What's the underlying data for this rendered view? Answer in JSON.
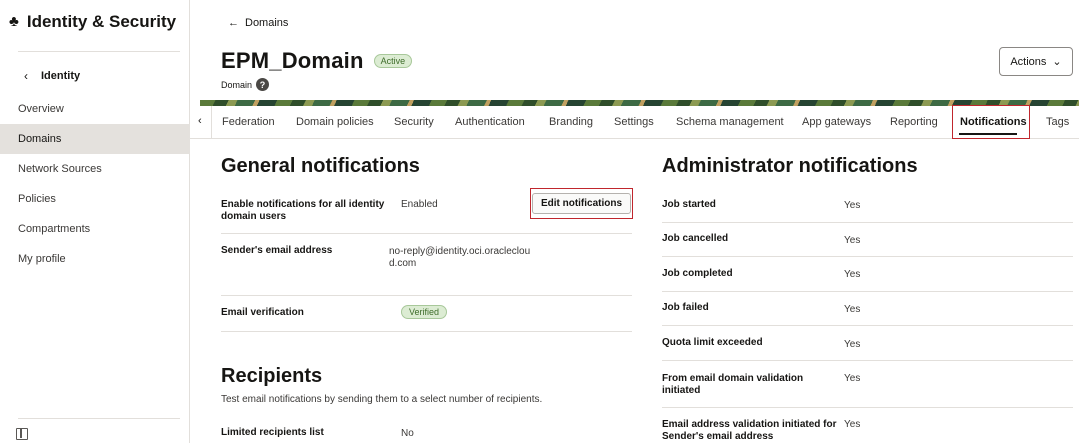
{
  "sidebar": {
    "brand_title": "Identity & Security",
    "brand_icon": "identity-security-logo",
    "back_label": "Identity",
    "items": [
      {
        "label": "Overview"
      },
      {
        "label": "Domains",
        "active": true
      },
      {
        "label": "Network Sources"
      },
      {
        "label": "Policies"
      },
      {
        "label": "Compartments"
      },
      {
        "label": "My profile"
      }
    ]
  },
  "header": {
    "breadcrumb": "Domains",
    "title": "EPM_Domain",
    "status": "Active",
    "subtitle": "Domain",
    "actions_label": "Actions"
  },
  "tabs": [
    {
      "label": "Federation"
    },
    {
      "label": "Domain policies"
    },
    {
      "label": "Security"
    },
    {
      "label": "Authentication"
    },
    {
      "label": "Branding"
    },
    {
      "label": "Settings"
    },
    {
      "label": "Schema management"
    },
    {
      "label": "App gateways"
    },
    {
      "label": "Reporting"
    },
    {
      "label": "Notifications",
      "active": true
    },
    {
      "label": "Tags"
    }
  ],
  "general": {
    "title": "General notifications",
    "edit_label": "Edit notifications",
    "rows": [
      {
        "label": "Enable notifications for all identity domain users",
        "value": "Enabled"
      },
      {
        "label": "Sender's email address",
        "value": "no-reply@identity.oci.oraclecloud.com"
      },
      {
        "label": "Email verification",
        "value": "Verified"
      }
    ]
  },
  "recipients": {
    "title": "Recipients",
    "description": "Test email notifications by sending them to a select number of recipients.",
    "rows": [
      {
        "label": "Limited recipients list",
        "value": "No"
      }
    ]
  },
  "admin": {
    "title": "Administrator notifications",
    "rows": [
      {
        "label": "Job started",
        "value": "Yes"
      },
      {
        "label": "Job cancelled",
        "value": "Yes"
      },
      {
        "label": "Job completed",
        "value": "Yes"
      },
      {
        "label": "Job failed",
        "value": "Yes"
      },
      {
        "label": "Quota limit exceeded",
        "value": "Yes"
      },
      {
        "label": "From email domain validation initiated",
        "value": "Yes"
      },
      {
        "label": "Email address validation initiated for Sender's email address",
        "value": "Yes"
      }
    ]
  },
  "colors": {
    "accent_highlight": "#c0262d",
    "status_green": "#3f6d2b",
    "active_nav_bg": "#e4e1dd"
  }
}
